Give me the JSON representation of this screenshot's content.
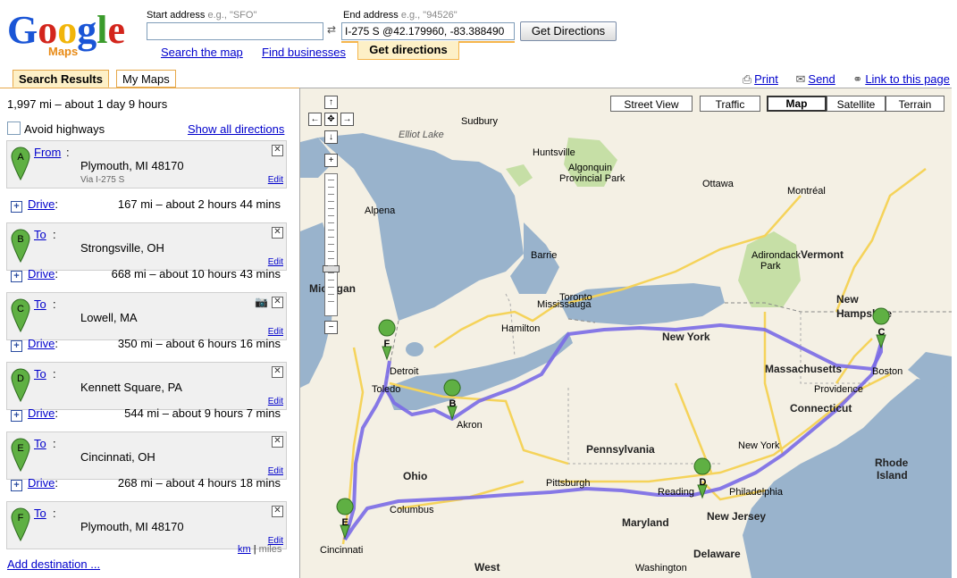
{
  "header": {
    "logo_text": "Google",
    "logo_sub": "Maps",
    "start_label": "Start address",
    "start_hint": "e.g., \"SFO\"",
    "start_value": "",
    "end_label": "End address",
    "end_hint": "e.g., \"94526\"",
    "end_value": "I-275 S @42.179960, -83.388490",
    "swap_glyph": "⇄",
    "get_button": "Get Directions",
    "links": {
      "search": "Search the map",
      "find": "Find businesses",
      "directions": "Get directions"
    }
  },
  "tabs": {
    "search_results": "Search Results",
    "my_maps": "My Maps"
  },
  "top_links": {
    "print": "Print",
    "send": "Send",
    "link": "Link to this page"
  },
  "panel": {
    "summary": "1,997 mi – about 1 day 9 hours",
    "avoid_highways": "Avoid highways",
    "show_all": "Show all directions",
    "stops": [
      {
        "letter": "A",
        "role": "From",
        "place": "Plymouth, MI 48170",
        "via": "Via I-275 S",
        "edit": "Edit"
      },
      {
        "letter": "B",
        "role": "To",
        "place": "Strongsville, OH",
        "edit": "Edit"
      },
      {
        "letter": "C",
        "role": "To",
        "place": "Lowell, MA",
        "edit": "Edit"
      },
      {
        "letter": "D",
        "role": "To",
        "place": "Kennett Square, PA",
        "edit": "Edit"
      },
      {
        "letter": "E",
        "role": "To",
        "place": "Cincinnati, OH",
        "edit": "Edit"
      },
      {
        "letter": "F",
        "role": "To",
        "place": "Plymouth, MI 48170",
        "edit": "Edit"
      }
    ],
    "drives": [
      {
        "label": "Drive",
        "dist": "167 mi – about 2 hours 44 mins"
      },
      {
        "label": "Drive",
        "dist": "668 mi – about 10 hours 43 mins"
      },
      {
        "label": "Drive",
        "dist": "350 mi – about 6 hours 16 mins"
      },
      {
        "label": "Drive",
        "dist": "544 mi – about 9 hours 7 mins"
      },
      {
        "label": "Drive",
        "dist": "268 mi – about 4 hours 18 mins"
      }
    ],
    "units_km": "km",
    "units_sep": "|",
    "units_miles": "miles",
    "add_destination": "Add destination ..."
  },
  "map": {
    "buttons": {
      "street_view": "Street View",
      "traffic": "Traffic",
      "map": "Map",
      "satellite": "Satellite",
      "terrain": "Terrain"
    },
    "colors": {
      "water": "#99b3cc",
      "land": "#f4f0e4",
      "park": "#c6dfa6",
      "route": "#7a6ae6",
      "highway": "#f5d35a",
      "pin": "#5fb043"
    }
  },
  "colors": {
    "accent_orange": "#f5b54b",
    "tab_bg": "#fdf0c7",
    "link": "#0000cc"
  }
}
